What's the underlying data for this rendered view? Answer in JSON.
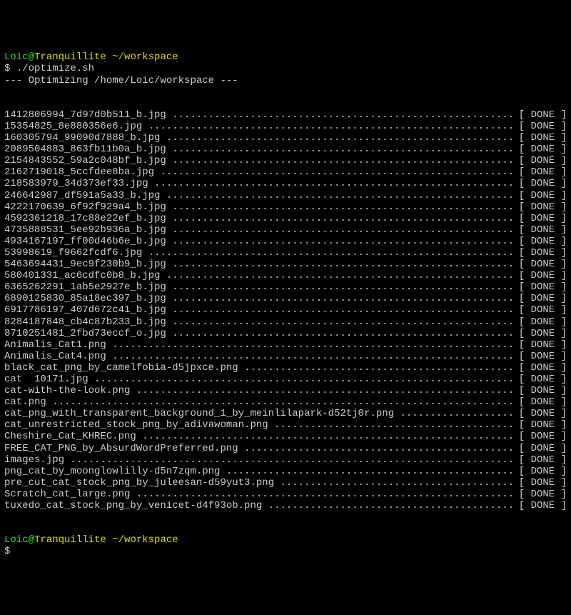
{
  "prompt": {
    "user": "Loic",
    "at": "@",
    "host": "Tranquillite",
    "path": "~/workspace",
    "dollar": "$",
    "command": "./optimize.sh"
  },
  "banner": "--- Optimizing /home/Loic/workspace ---",
  "files": [
    {
      "name": "1412806994_7d97d0b511_b.jpg",
      "status": "[ DONE ]"
    },
    {
      "name": "15354825_8e880356e6.jpg",
      "status": "[ DONE ]"
    },
    {
      "name": "160305794_99090d7888_b.jpg",
      "status": "[ DONE ]"
    },
    {
      "name": "2089504883_863fb11b0a_b.jpg",
      "status": "[ DONE ]"
    },
    {
      "name": "2154843552_59a2c048bf_b.jpg",
      "status": "[ DONE ]"
    },
    {
      "name": "2162719018_5ccfdee8ba.jpg",
      "status": "[ DONE ]"
    },
    {
      "name": "218583979_34d373ef33.jpg",
      "status": "[ DONE ]"
    },
    {
      "name": "246642987_df591a5a33_b.jpg",
      "status": "[ DONE ]"
    },
    {
      "name": "4222170639_6f92f929a4_b.jpg",
      "status": "[ DONE ]"
    },
    {
      "name": "4592361218_17c88e22ef_b.jpg",
      "status": "[ DONE ]"
    },
    {
      "name": "4735888531_5ee92b936a_b.jpg",
      "status": "[ DONE ]"
    },
    {
      "name": "4934167197_ff00d46b6e_b.jpg",
      "status": "[ DONE ]"
    },
    {
      "name": "53998619_f9662fcdf6.jpg",
      "status": "[ DONE ]"
    },
    {
      "name": "5463694431_9ec9f230b9_b.jpg",
      "status": "[ DONE ]"
    },
    {
      "name": "580401331_ac6cdfc0b8_b.jpg",
      "status": "[ DONE ]"
    },
    {
      "name": "6365262291_1ab5e2927e_b.jpg",
      "status": "[ DONE ]"
    },
    {
      "name": "6890125830_85a18ec397_b.jpg",
      "status": "[ DONE ]"
    },
    {
      "name": "6917786197_407d672c41_b.jpg",
      "status": "[ DONE ]"
    },
    {
      "name": "8284187848_cb4c87b233_b.jpg",
      "status": "[ DONE ]"
    },
    {
      "name": "8710251481_2fbd73eccf_o.jpg",
      "status": "[ DONE ]"
    },
    {
      "name": "Animalis_Cat1.png",
      "status": "[ DONE ]"
    },
    {
      "name": "Animalis_Cat4.png",
      "status": "[ DONE ]"
    },
    {
      "name": "black_cat_png_by_camelfobia-d5jpxce.png",
      "status": "[ DONE ]"
    },
    {
      "name": "cat  10171.jpg",
      "status": "[ DONE ]"
    },
    {
      "name": "cat-with-the-look.png",
      "status": "[ DONE ]"
    },
    {
      "name": "cat.png",
      "status": "[ DONE ]"
    },
    {
      "name": "cat_png_with_transparent_background_1_by_meinlilapark-d52tj0r.png",
      "status": "[ DONE ]"
    },
    {
      "name": "cat_unrestricted_stock_png_by_adivawoman.png",
      "status": "[ DONE ]"
    },
    {
      "name": "Cheshire_Cat_KHREC.png",
      "status": "[ DONE ]"
    },
    {
      "name": "FREE_CAT_PNG_by_AbsurdWordPreferred.png",
      "status": "[ DONE ]"
    },
    {
      "name": "images.jpg",
      "status": "[ DONE ]"
    },
    {
      "name": "png_cat_by_moonglowlilly-d5n7zqm.png",
      "status": "[ DONE ]"
    },
    {
      "name": "pre_cut_cat_stock_png_by_juleesan-d59yut3.png",
      "status": "[ DONE ]"
    },
    {
      "name": "Scratch_cat_large.png",
      "status": "[ DONE ]"
    },
    {
      "name": "tuxedo_cat_stock_png_by_venicet-d4f93ob.png",
      "status": "[ DONE ]"
    }
  ]
}
